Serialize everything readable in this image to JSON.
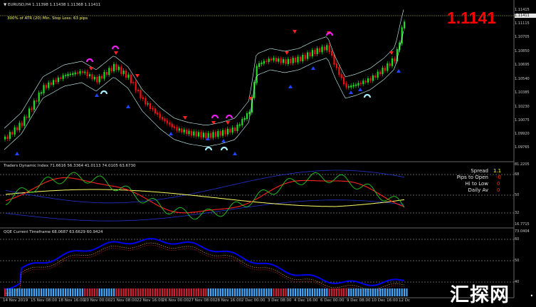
{
  "chart": {
    "symbol_header": "▼ EURUSD,H4  1.11398  1.11438  1.11368  1.11411",
    "big_price": "1.1141",
    "atr_info": "300% of ATR (20)    Min. Stop Loss:   63 pips",
    "price_labels": [
      "1.11415",
      "1.11411",
      "1.11115",
      "1.10705",
      "1.10850",
      "1.10695",
      "1.10540",
      "1.10385",
      "1.10230",
      "1.10075",
      "1.09920",
      "1.09765"
    ],
    "current_price": "1.11411"
  },
  "tdi": {
    "header": "Traders Dynamic Index 71.6616 56.3364 41.0113 74.0105 63.6730",
    "scale_labels": [
      "81.2205",
      "68",
      "50",
      "32",
      "16.7715"
    ],
    "stats": [
      {
        "label": "Spread",
        "value": "1.1",
        "color": "#ffff00"
      },
      {
        "label": "Pips to Open",
        "value": "-0",
        "color": "#ff3300"
      },
      {
        "label": "Hi to Low",
        "value": "0",
        "color": "#ff3300"
      },
      {
        "label": "Daily Av",
        "value": "0",
        "color": "#ff3300"
      }
    ]
  },
  "qqe": {
    "header": "QQE Current Timeframe 68.0687 63.6629 60.9424",
    "scale_labels": [
      "73.0404",
      "60",
      "50",
      "40"
    ]
  },
  "time_axis": {
    "labels": [
      "14 Nov 2019",
      "15 Nov 08:00",
      "18 Nov 16:00",
      "20 Nov 00:00",
      "21 Nov 08:00",
      "22 Nov 16:00",
      "26 Nov 00:00",
      "27 Nov 08:00",
      "28 Nov 16:00",
      "2 Dec 00:00",
      "3 Dec 08:00",
      "4 Dec 16:00",
      "6 Dec 00:00",
      "9 Dec 08:00",
      "10 Dec 16:00",
      "12 Dc"
    ]
  },
  "watermark": {
    "text": "汇探网",
    "dot": "."
  },
  "colors": {
    "bull": "#22dd22",
    "bear": "#ee1111",
    "band": "#ccffff",
    "tdi_red": "#ff2222",
    "tdi_green": "#22cc22",
    "tdi_yellow": "#ffff66",
    "tdi_blue": "#2233cc",
    "qqe_blue": "#0000ee"
  }
}
